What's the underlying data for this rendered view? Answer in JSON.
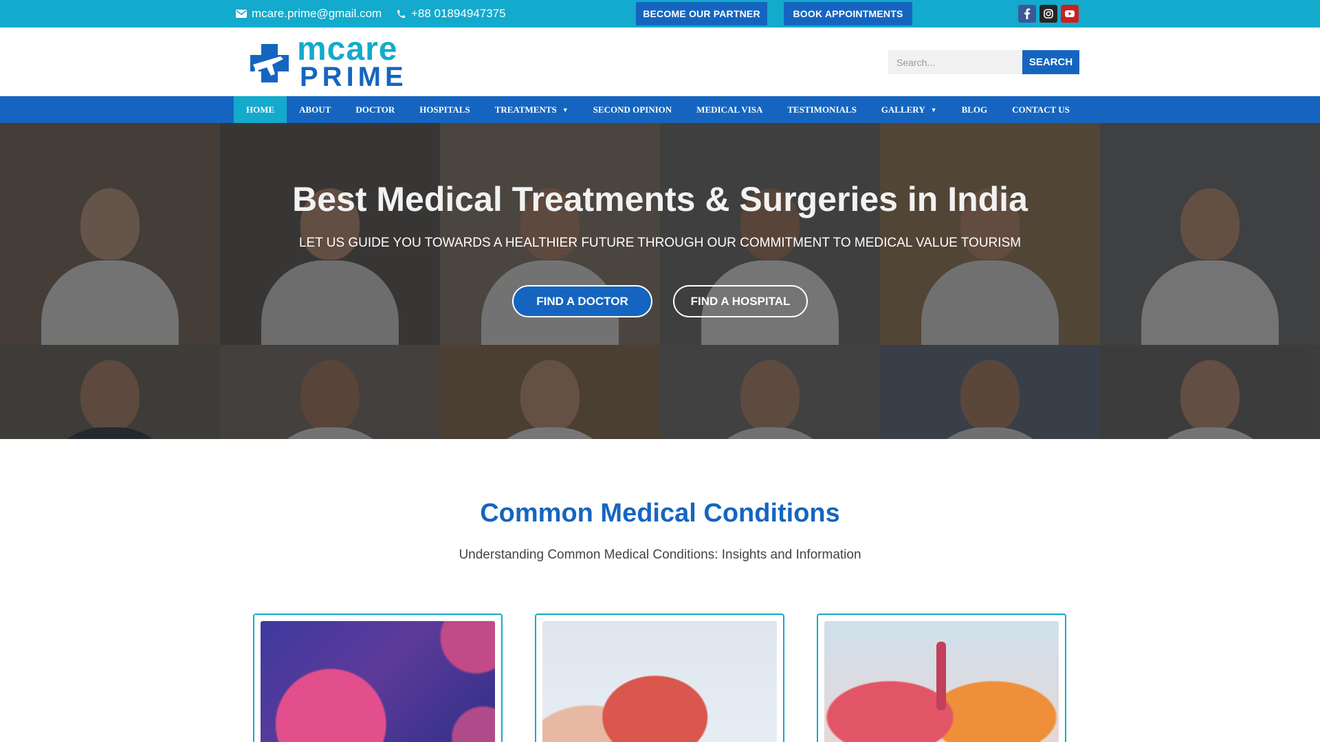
{
  "topbar": {
    "email": "mcare.prime@gmail.com",
    "phone": "+88 01894947375",
    "partner_label": "BECOME OUR PARTNER",
    "appointments_label": "BOOK APPOINTMENTS",
    "social": [
      "facebook-icon",
      "instagram-icon",
      "youtube-icon"
    ],
    "bg_color": "#13aacd"
  },
  "header": {
    "logo_line1": "mcare",
    "logo_line2": "PRIME",
    "search_placeholder": "Search...",
    "search_label": "SEARCH"
  },
  "nav": {
    "items": [
      {
        "label": "HOME",
        "active": true
      },
      {
        "label": "ABOUT"
      },
      {
        "label": "DOCTOR"
      },
      {
        "label": "HOSPITALS"
      },
      {
        "label": "TREATMENTS",
        "dropdown": true
      },
      {
        "label": "SECOND OPINION"
      },
      {
        "label": "MEDICAL VISA"
      },
      {
        "label": "TESTIMONIALS"
      },
      {
        "label": "GALLERY",
        "dropdown": true
      },
      {
        "label": "BLOG"
      },
      {
        "label": "CONTACT US"
      }
    ],
    "bg_color": "#1565c0",
    "active_color": "#13aacd"
  },
  "hero": {
    "title": "Best Medical Treatments & Surgeries in India",
    "subtitle": "LET US GUIDE YOU TOWARDS A HEALTHIER FUTURE THROUGH OUR COMMITMENT TO MEDICAL VALUE TOURISM",
    "find_doctor": "FIND A DOCTOR",
    "find_hospital": "FIND A HOSPITAL"
  },
  "conditions": {
    "title": "Common Medical Conditions",
    "subtitle": "Understanding Common Medical Conditions: Insights and Information"
  },
  "colors": {
    "primary": "#1565c0",
    "accent": "#13aacd"
  }
}
